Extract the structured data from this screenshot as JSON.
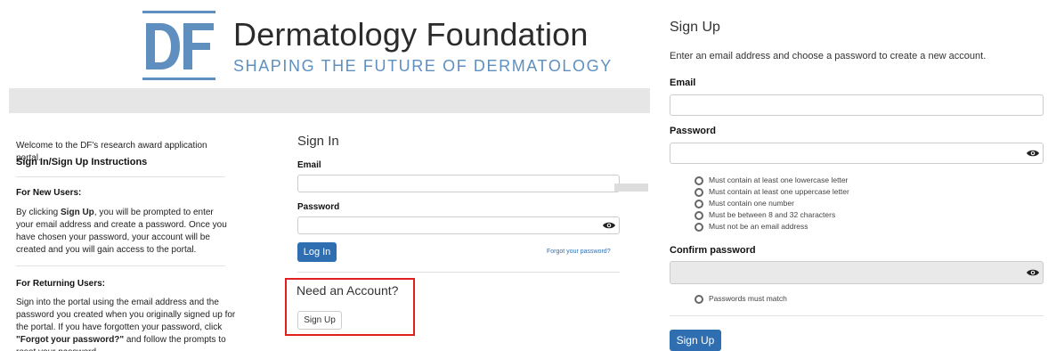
{
  "logo": {
    "title": "Dermatology Foundation",
    "tagline": "SHAPING THE FUTURE OF DERMATOLOGY"
  },
  "instructions": {
    "welcome": "Welcome to the DF's research award application portal.",
    "heading": "Sign In/Sign Up Instructions",
    "new_users_heading": "For New Users:",
    "new_users_p1": "By clicking ",
    "new_users_signup": "Sign Up",
    "new_users_p2": ", you will be prompted to enter your email address and create a password. Once you have chosen your password, your account will be created and you will gain access to the portal.",
    "returning_heading": "For Returning Users:",
    "returning_p1": "Sign into the portal using the email address and the password you created when you originally signed up for the portal. If you have forgotten your password, click ",
    "returning_forgot": "\"Forgot your password?\"",
    "returning_p2": " and follow the prompts to reset your password."
  },
  "signin": {
    "title": "Sign In",
    "email_label": "Email",
    "password_label": "Password",
    "login_button": "Log In",
    "forgot_link": "Forgot your password?",
    "need_account": "Need an Account?",
    "signup_button": "Sign Up"
  },
  "signup_form": {
    "title": "Sign Up",
    "description": "Enter an email address and choose a password to create a new account.",
    "email_label": "Email",
    "password_label": "Password",
    "rules": [
      "Must contain at least one lowercase letter",
      "Must contain at least one uppercase letter",
      "Must contain one number",
      "Must be between 8 and 32 characters",
      "Must not be an email address"
    ],
    "confirm_label": "Confirm password",
    "match_rule": "Passwords must match",
    "submit_button": "Sign Up"
  },
  "colors": {
    "brand_blue": "#5f8fbf",
    "primary_button": "#2f6fb1",
    "highlight_box": "#e02020"
  }
}
